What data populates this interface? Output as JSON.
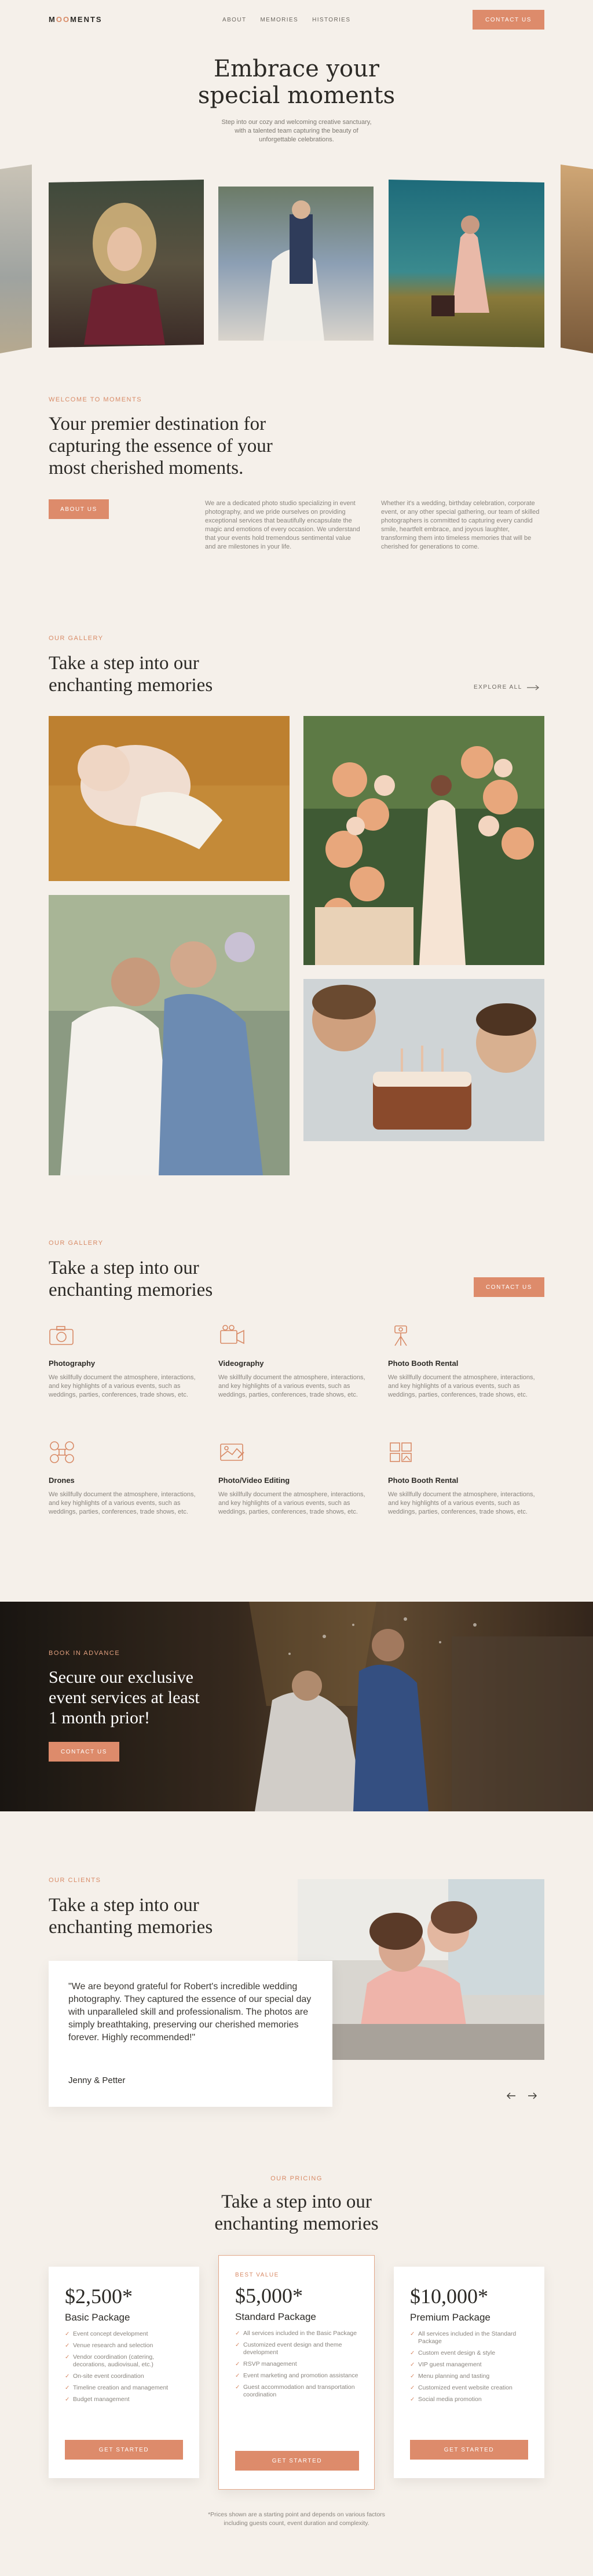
{
  "nav": {
    "logo": "M",
    "logo_oo": "OO",
    "logo_rest": "MENTS",
    "links": [
      "ABOUT",
      "MEMORIES",
      "HISTORIES"
    ],
    "cta": "CONTACT US"
  },
  "hero": {
    "title_line1": "Embrace your",
    "title_line2": "special moments",
    "subtitle_line1": "Step into our cozy and welcoming creative sanctuary,",
    "subtitle_line2": "with a talented team capturing the beauty of",
    "subtitle_line3": "unforgettable celebrations."
  },
  "welcome": {
    "eyebrow": "WELCOME TO MOMENTS",
    "heading_line1": "Your premier destination for",
    "heading_line2": "capturing the essence of your",
    "heading_line3": "most cherished moments.",
    "button": "ABOUT US",
    "col1": "We are a dedicated photo studio specializing in event photography, and we pride ourselves on providing exceptional services that beautifully encapsulate the magic and emotions of every occasion. We understand that your events hold tremendous sentimental value and are milestones in your life.",
    "col2": "Whether it's a wedding, birthday celebration, corporate event, or any other special gathering, our team of skilled photographers is committed to capturing every candid smile, heartfelt embrace, and joyous laughter, transforming them into timeless memories that will be cherished for generations to come."
  },
  "gallery": {
    "eyebrow": "OUR GALLERY",
    "heading_line1": "Take a step into our",
    "heading_line2": "enchanting memories",
    "explore": "EXPLORE ALL"
  },
  "services": {
    "eyebrow": "OUR GALLERY",
    "heading_line1": "Take a step into our",
    "heading_line2": "enchanting memories",
    "cta": "CONTACT US",
    "items": [
      {
        "title": "Photography",
        "text": "We skillfully document the atmosphere, interactions, and key highlights of a various events, such as weddings, parties, conferences, trade shows, etc.",
        "icon": "camera-icon"
      },
      {
        "title": "Videography",
        "text": "We skillfully document the atmosphere, interactions, and key highlights of a various events, such as weddings, parties, conferences, trade shows, etc.",
        "icon": "video-camera-icon"
      },
      {
        "title": "Photo Booth Rental",
        "text": "We skillfully document the atmosphere, interactions, and key highlights of a various events, such as weddings, parties, conferences, trade shows, etc.",
        "icon": "photo-booth-icon"
      },
      {
        "title": "Drones",
        "text": "We skillfully document the atmosphere, interactions, and key highlights of a various events, such as weddings, parties, conferences, trade shows, etc.",
        "icon": "drone-icon"
      },
      {
        "title": "Photo/Video Editing",
        "text": "We skillfully document the atmosphere, interactions, and key highlights of a various events, such as weddings, parties, conferences, trade shows, etc.",
        "icon": "editing-icon"
      },
      {
        "title": "Photo Booth Rental",
        "text": "We skillfully document the atmosphere, interactions, and key highlights of a various events, such as weddings, parties, conferences, trade shows, etc.",
        "icon": "album-icon"
      }
    ]
  },
  "booking": {
    "eyebrow": "BOOK IN ADVANCE",
    "heading_line1": "Secure our exclusive",
    "heading_line2": "event services at least",
    "heading_line3": "1 month prior!",
    "button": "CONTACT US"
  },
  "testimonial": {
    "eyebrow": "OUR CLIENTS",
    "heading_line1": "Take a step into our",
    "heading_line2": "enchanting memories",
    "quote": "\"We are beyond grateful for Robert's incredible wedding photography. They captured the essence of our special day with unparalleled skill and professionalism. The photos are simply breathtaking, preserving our cherished memories forever. Highly recommended!\"",
    "author": "Jenny & Petter"
  },
  "pricing": {
    "eyebrow": "OUR PRICING",
    "heading_line1": "Take a step into our",
    "heading_line2": "enchanting memories",
    "best_value": "BEST VALUE",
    "button": "GET STARTED",
    "footnote_line1": "*Prices shown are a starting point and depends on various factors",
    "footnote_line2": "including guests count, event duration and complexity.",
    "plans": [
      {
        "price": "$2,500*",
        "name": "Basic Package",
        "features": [
          "Event concept development",
          "Venue research and selection",
          "Vendor coordination (catering, decorations, audiovisual, etc.)",
          "On-site event coordination",
          "Timeline creation and management",
          "Budget management"
        ]
      },
      {
        "price": "$5,000*",
        "name": "Standard Package",
        "features": [
          "All services included in the Basic Package",
          "Customized event design and theme development",
          "RSVP management",
          "Event marketing and promotion assistance",
          "Guest accommodation and transportation coordination"
        ]
      },
      {
        "price": "$10,000*",
        "name": "Premium Package",
        "features": [
          "All services included in the Standard Package",
          "Custom event design & style",
          "VIP guest management",
          "Menu planning and tasting",
          "Customized event website creation",
          "Social media promotion"
        ]
      }
    ]
  },
  "colors": {
    "accent": "#dd8b6b",
    "background": "#f5f0ea",
    "text": "#2c2a26"
  }
}
